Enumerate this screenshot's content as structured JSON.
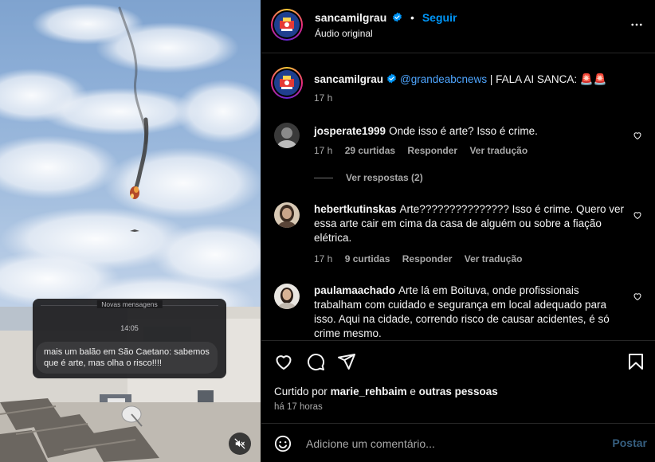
{
  "media": {
    "chat": {
      "new_messages_label": "Novas mensagens",
      "time": "14:05",
      "message": "mais um balão em São Caetano: sabemos que é arte, mas olha o risco!!!!"
    },
    "mute_icon": "speaker-muted-icon"
  },
  "header": {
    "username": "sancamilgrau",
    "dot": "•",
    "follow_label": "Seguir",
    "audio_label": "Áudio original",
    "more_icon": "more-options-icon"
  },
  "caption": {
    "username": "sancamilgrau",
    "mention": "@grandeabcnews",
    "text": " | FALA AI SANCA: 🚨🚨",
    "time": "17 h"
  },
  "comments": [
    {
      "username": "josperate1999",
      "text": "Onde isso é arte? Isso é crime.",
      "time": "17 h",
      "likes": "29 curtidas",
      "reply": "Responder",
      "translate": "Ver tradução",
      "view_replies": "Ver respostas (2)"
    },
    {
      "username": "hebertkutinskas",
      "text": "Arte??????????????? Isso é crime. Quero ver essa arte cair em cima da casa de alguém ou sobre a fiação elétrica.",
      "time": "17 h",
      "likes": "9 curtidas",
      "reply": "Responder",
      "translate": "Ver tradução"
    },
    {
      "username": "paulamaachado",
      "text": "Arte lá em Boituva, onde profissionais trabalham com cuidado e segurança em local adequado para isso. Aqui na cidade, correndo risco de causar acidentes, é só crime mesmo."
    }
  ],
  "actions": {
    "liked_by_prefix": "Curtido por",
    "liked_by_user": "marie_rehbaim",
    "liked_by_and": "e",
    "liked_by_others": "outras pessoas",
    "time_ago": "há 17 horas"
  },
  "add_comment": {
    "placeholder": "Adicione um comentário...",
    "post_label": "Postar"
  },
  "colors": {
    "accent": "#0095f6",
    "background": "#000000",
    "muted_text": "#a8a8a8",
    "post_disabled": "#365f80"
  }
}
